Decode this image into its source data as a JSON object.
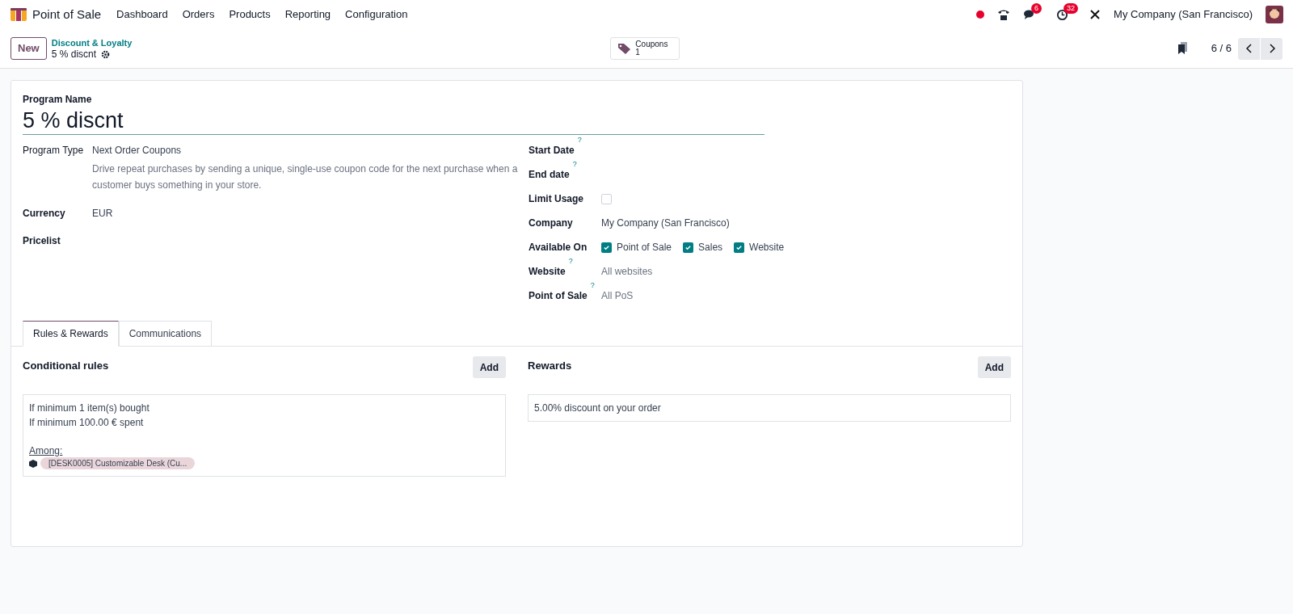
{
  "navbar": {
    "app_name": "Point of Sale",
    "menu": [
      "Dashboard",
      "Orders",
      "Products",
      "Reporting",
      "Configuration"
    ],
    "messages_count": "6",
    "activities_count": "32",
    "company": "My Company (San Francisco)"
  },
  "control_panel": {
    "new_button": "New",
    "breadcrumb": "Discount & Loyalty",
    "record_name": "5 % discnt",
    "smart_button": {
      "label": "Coupons",
      "count": "1"
    },
    "pager": "6 / 6"
  },
  "form": {
    "name_label": "Program Name",
    "name": "5 % discnt",
    "left_fields": [
      {
        "label": "Program Type",
        "value": "Next Order Coupons",
        "help": "Drive repeat purchases by sending a unique, single-use coupon code for the next purchase when a customer buys something in your store.",
        "bold": false
      },
      {
        "label": "Currency",
        "value": "EUR",
        "bold": true
      },
      {
        "label": "Pricelist",
        "bold": true
      }
    ],
    "right_fields": [
      {
        "kind": "text",
        "label": "Start Date",
        "tooltip": "?"
      },
      {
        "kind": "text",
        "label": "End date",
        "tooltip": "?"
      },
      {
        "kind": "checkbox",
        "label": "Limit Usage",
        "checked": false
      },
      {
        "kind": "text",
        "label": "Company",
        "value": "My Company (San Francisco)"
      },
      {
        "kind": "checks",
        "label": "Available On",
        "options": [
          {
            "label": "Point of Sale",
            "checked": true
          },
          {
            "label": "Sales",
            "checked": true
          },
          {
            "label": "Website",
            "checked": true
          }
        ]
      },
      {
        "kind": "text",
        "label": "Website",
        "tooltip": "?",
        "value": "All websites",
        "muted": true
      },
      {
        "kind": "text",
        "label": "Point of Sale",
        "tooltip": "?",
        "value": "All PoS",
        "muted": true
      }
    ],
    "tabs": [
      {
        "label": "Rules & Rewards",
        "selected": true
      },
      {
        "label": "Communications",
        "selected": false
      }
    ],
    "rules": {
      "title": "Conditional rules",
      "add": "Add",
      "lines": [
        "If minimum 1 item(s) bought",
        "If minimum 100.00 € spent"
      ],
      "among": "Among:",
      "product_tag": "[DESK0005] Customizable Desk (Cu..."
    },
    "rewards": {
      "title": "Rewards",
      "add": "Add",
      "lines": [
        "5.00% discount on your order"
      ]
    }
  }
}
